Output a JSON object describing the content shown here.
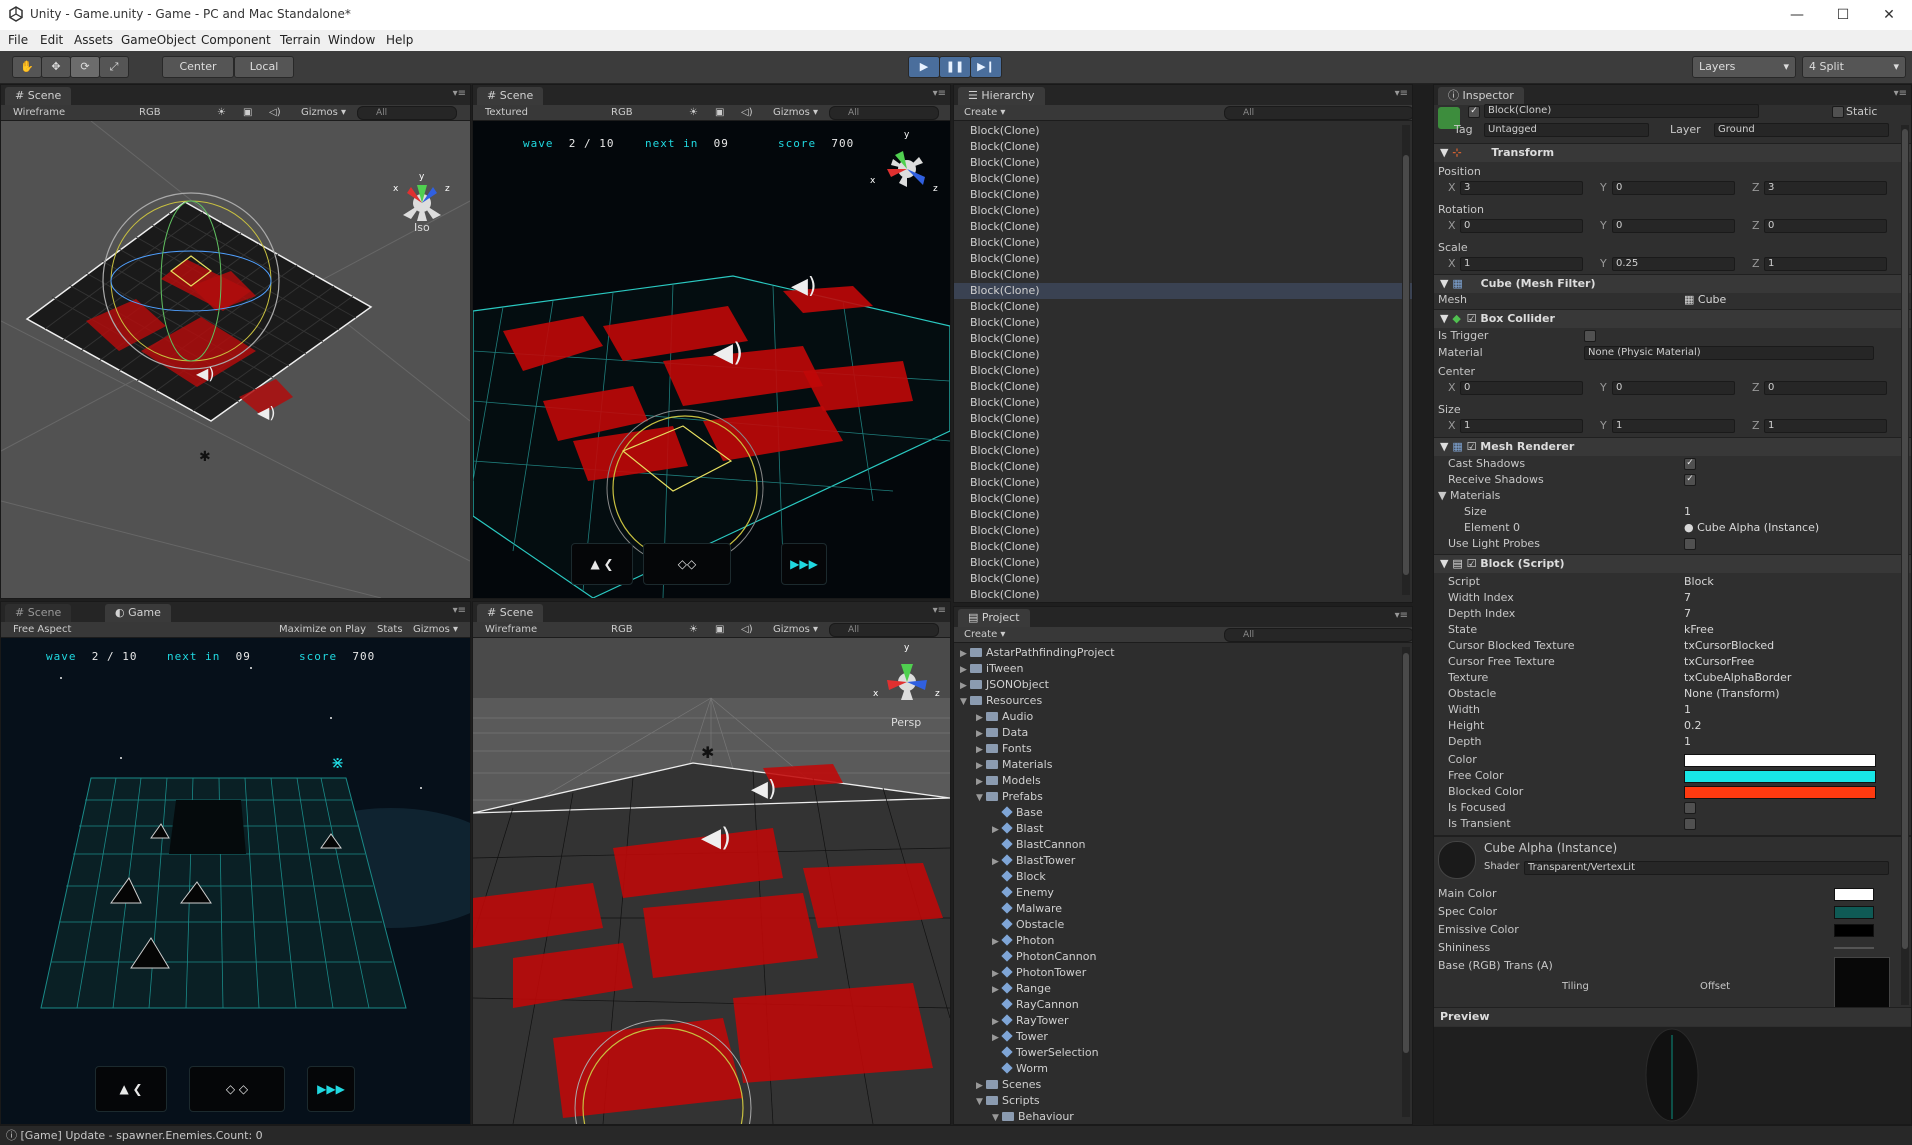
{
  "window": {
    "title": "Unity - Game.unity - Game - PC and Mac Standalone*",
    "minimize": "—",
    "maximize": "☐",
    "close": "✕"
  },
  "menu": [
    "File",
    "Edit",
    "Assets",
    "GameObject",
    "Component",
    "Terrain",
    "Window",
    "Help"
  ],
  "toolbar": {
    "pivot": "Center",
    "space": "Local",
    "layers": "Layers",
    "layout": "4 Split"
  },
  "scene_iso": {
    "tab": "Scene",
    "shading": "Wireframe",
    "render": "RGB",
    "gizmos": "Gizmos",
    "search": "All",
    "projection": "Iso"
  },
  "scene_textured": {
    "tab": "Scene",
    "shading": "Textured",
    "render": "RGB",
    "gizmos": "Gizmos",
    "search": "All"
  },
  "game_view": {
    "tab_scene": "Scene",
    "tab_game": "Game",
    "aspect": "Free Aspect",
    "maximize": "Maximize on Play",
    "stats": "Stats",
    "gizmos": "Gizmos"
  },
  "scene_persp": {
    "tab": "Scene",
    "shading": "Wireframe",
    "render": "RGB",
    "gizmos": "Gizmos",
    "search": "All",
    "projection": "Persp"
  },
  "hud": {
    "wave_label": "wave",
    "wave_value": "2 / 10",
    "next_label": "next in",
    "next_value": "09",
    "score_label": "score",
    "score_value": "700"
  },
  "hierarchy": {
    "tab": "Hierarchy",
    "create": "Create",
    "search": "All",
    "items": [
      "Block(Clone)",
      "Block(Clone)",
      "Block(Clone)",
      "Block(Clone)",
      "Block(Clone)",
      "Block(Clone)",
      "Block(Clone)",
      "Block(Clone)",
      "Block(Clone)",
      "Block(Clone)",
      "Block(Clone)",
      "Block(Clone)",
      "Block(Clone)",
      "Block(Clone)",
      "Block(Clone)",
      "Block(Clone)",
      "Block(Clone)",
      "Block(Clone)",
      "Block(Clone)",
      "Block(Clone)",
      "Block(Clone)",
      "Block(Clone)",
      "Block(Clone)",
      "Block(Clone)",
      "Block(Clone)",
      "Block(Clone)",
      "Block(Clone)",
      "Block(Clone)",
      "Block(Clone)",
      "Block(Clone)"
    ]
  },
  "project": {
    "tab": "Project",
    "create": "Create",
    "search": "All",
    "items": [
      {
        "label": "AstarPathfindingProject",
        "depth": 0,
        "kind": "folder",
        "arrow": "▶"
      },
      {
        "label": "iTween",
        "depth": 0,
        "kind": "folder",
        "arrow": "▶"
      },
      {
        "label": "JSONObject",
        "depth": 0,
        "kind": "folder",
        "arrow": "▶"
      },
      {
        "label": "Resources",
        "depth": 0,
        "kind": "folder",
        "arrow": "▼"
      },
      {
        "label": "Audio",
        "depth": 1,
        "kind": "folder",
        "arrow": "▶"
      },
      {
        "label": "Data",
        "depth": 1,
        "kind": "folder",
        "arrow": "▶"
      },
      {
        "label": "Fonts",
        "depth": 1,
        "kind": "folder",
        "arrow": "▶"
      },
      {
        "label": "Materials",
        "depth": 1,
        "kind": "folder",
        "arrow": "▶"
      },
      {
        "label": "Models",
        "depth": 1,
        "kind": "folder",
        "arrow": "▶"
      },
      {
        "label": "Prefabs",
        "depth": 1,
        "kind": "folder",
        "arrow": "▼"
      },
      {
        "label": "Base",
        "depth": 2,
        "kind": "prefab",
        "arrow": ""
      },
      {
        "label": "Blast",
        "depth": 2,
        "kind": "prefab",
        "arrow": "▶"
      },
      {
        "label": "BlastCannon",
        "depth": 2,
        "kind": "prefab",
        "arrow": ""
      },
      {
        "label": "BlastTower",
        "depth": 2,
        "kind": "prefab",
        "arrow": "▶"
      },
      {
        "label": "Block",
        "depth": 2,
        "kind": "prefab",
        "arrow": ""
      },
      {
        "label": "Enemy",
        "depth": 2,
        "kind": "prefab",
        "arrow": ""
      },
      {
        "label": "Malware",
        "depth": 2,
        "kind": "prefab",
        "arrow": ""
      },
      {
        "label": "Obstacle",
        "depth": 2,
        "kind": "prefab",
        "arrow": ""
      },
      {
        "label": "Photon",
        "depth": 2,
        "kind": "prefab",
        "arrow": "▶"
      },
      {
        "label": "PhotonCannon",
        "depth": 2,
        "kind": "prefab",
        "arrow": ""
      },
      {
        "label": "PhotonTower",
        "depth": 2,
        "kind": "prefab",
        "arrow": "▶"
      },
      {
        "label": "Range",
        "depth": 2,
        "kind": "prefab",
        "arrow": "▶"
      },
      {
        "label": "RayCannon",
        "depth": 2,
        "kind": "prefab",
        "arrow": ""
      },
      {
        "label": "RayTower",
        "depth": 2,
        "kind": "prefab",
        "arrow": "▶"
      },
      {
        "label": "Tower",
        "depth": 2,
        "kind": "prefab",
        "arrow": "▶"
      },
      {
        "label": "TowerSelection",
        "depth": 2,
        "kind": "prefab",
        "arrow": ""
      },
      {
        "label": "Worm",
        "depth": 2,
        "kind": "prefab",
        "arrow": ""
      },
      {
        "label": "Scenes",
        "depth": 1,
        "kind": "folder",
        "arrow": "▶"
      },
      {
        "label": "Scripts",
        "depth": 1,
        "kind": "folder",
        "arrow": "▼"
      },
      {
        "label": "Behaviour",
        "depth": 2,
        "kind": "folder",
        "arrow": "▼"
      }
    ]
  },
  "inspector": {
    "tab": "Inspector",
    "object_name": "Block(Clone)",
    "static_label": "Static",
    "tag_label": "Tag",
    "tag_value": "Untagged",
    "layer_label": "Layer",
    "layer_value": "Ground",
    "transform": {
      "header": "Transform",
      "position_label": "Position",
      "position": [
        "3",
        "0",
        "3"
      ],
      "rotation_label": "Rotation",
      "rotation": [
        "0",
        "0",
        "0"
      ],
      "scale_label": "Scale",
      "scale": [
        "1",
        "0.25",
        "1"
      ]
    },
    "axis": [
      "X",
      "Y",
      "Z"
    ],
    "mesh_filter": {
      "header": "Cube (Mesh Filter)",
      "mesh_label": "Mesh",
      "mesh_value": "Cube"
    },
    "box_collider": {
      "header": "Box Collider",
      "is_trigger": "Is Trigger",
      "material_label": "Material",
      "material_value": "None (Physic Material)",
      "center_label": "Center",
      "center": [
        "0",
        "0",
        "0"
      ],
      "size_label": "Size",
      "size": [
        "1",
        "1",
        "1"
      ]
    },
    "mesh_renderer": {
      "header": "Mesh Renderer",
      "cast_shadows": "Cast Shadows",
      "receive_shadows": "Receive Shadows",
      "materials": "Materials",
      "size_label": "Size",
      "size_value": "1",
      "element0_label": "Element 0",
      "element0_value": "Cube Alpha (Instance)",
      "light_probes": "Use Light Probes"
    },
    "block_script": {
      "header": "Block (Script)",
      "rows": [
        {
          "label": "Script",
          "value": "Block"
        },
        {
          "label": "Width Index",
          "value": "7"
        },
        {
          "label": "Depth Index",
          "value": "7"
        },
        {
          "label": "State",
          "value": "kFree"
        },
        {
          "label": "Cursor Blocked Texture",
          "value": "txCursorBlocked"
        },
        {
          "label": "Cursor Free Texture",
          "value": "txCursorFree"
        },
        {
          "label": "Texture",
          "value": "txCubeAlphaBorder"
        },
        {
          "label": "Obstacle",
          "value": "None (Transform)"
        },
        {
          "label": "Width",
          "value": "1"
        },
        {
          "label": "Height",
          "value": "0.2"
        },
        {
          "label": "Depth",
          "value": "1"
        }
      ],
      "color_label": "Color",
      "free_color_label": "Free Color",
      "blocked_color_label": "Blocked Color",
      "is_focused": "Is Focused",
      "is_transient": "Is Transient"
    },
    "material": {
      "name": "Cube Alpha (Instance)",
      "shader_label": "Shader",
      "shader_value": "Transparent/VertexLit",
      "main_color": "Main Color",
      "spec_color": "Spec Color",
      "emissive_color": "Emissive Color",
      "shininess": "Shininess",
      "base": "Base (RGB) Trans (A)",
      "tiling": "Tiling",
      "offset": "Offset"
    },
    "preview": "Preview"
  },
  "colors": {
    "color": "#ffffff",
    "free_color": "#18e6e6",
    "blocked_color": "#ff3a10",
    "main_color": "#ffffff",
    "spec_color": "#0f5a55",
    "emissive_color": "#000000",
    "hud_cyan": "#20d8e0",
    "block_red": "#c01010"
  },
  "status": "[Game] Update - spawner.Enemies.Count: 0"
}
